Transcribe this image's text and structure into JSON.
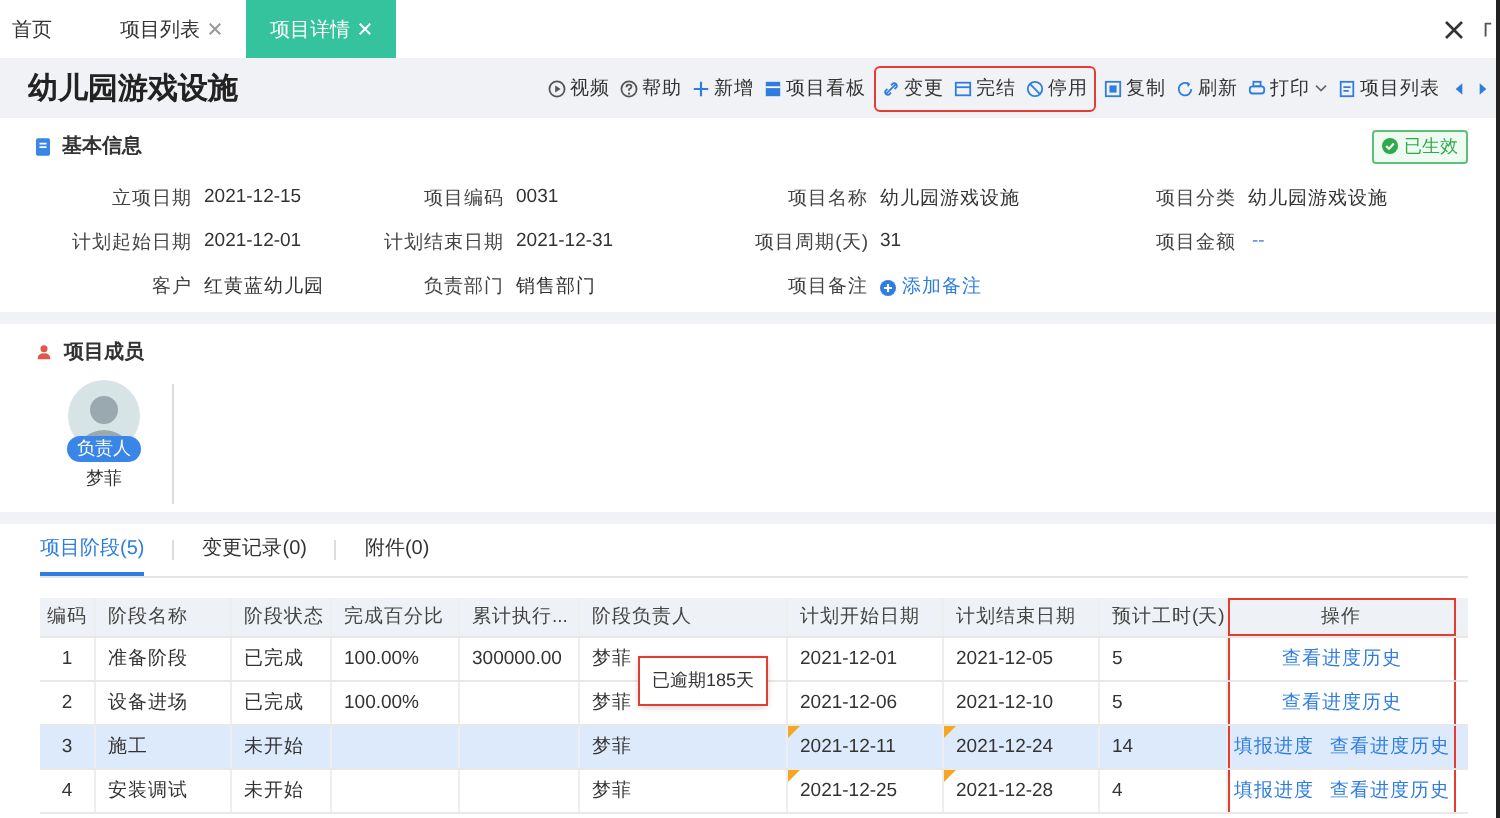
{
  "tabs": [
    {
      "label": "首页",
      "closable": false,
      "selected": false
    },
    {
      "label": "项目列表",
      "closable": true,
      "selected": false
    },
    {
      "label": "项目详情",
      "closable": true,
      "selected": true
    }
  ],
  "title": "幼儿园游戏设施",
  "toolbar_groups": [
    {
      "highlighted": false,
      "items": [
        {
          "label": "视频"
        },
        {
          "label": "帮助"
        },
        {
          "label": "新增"
        },
        {
          "label": "项目看板"
        }
      ]
    },
    {
      "highlighted": true,
      "items": [
        {
          "label": "变更"
        },
        {
          "label": "完结"
        },
        {
          "label": "停用"
        }
      ]
    },
    {
      "highlighted": false,
      "items": [
        {
          "label": "复制"
        },
        {
          "label": "刷新"
        },
        {
          "label": "打印",
          "dropdown": true
        },
        {
          "label": "项目列表"
        }
      ]
    }
  ],
  "basic_info": {
    "heading": "基本信息",
    "status": "已生效",
    "fields": [
      {
        "label": "立项日期",
        "value": "2021-12-15"
      },
      {
        "label": "项目编码",
        "value": "0031"
      },
      {
        "label": "项目名称",
        "value": "幼儿园游戏设施"
      },
      {
        "label": "项目分类",
        "value": "幼儿园游戏设施"
      },
      {
        "label": "计划起始日期",
        "value": "2021-12-01"
      },
      {
        "label": "计划结束日期",
        "value": "2021-12-31"
      },
      {
        "label": "项目周期(天)",
        "value": "31"
      },
      {
        "label": "项目金额",
        "value": "--",
        "kind": "empty"
      },
      {
        "label": "客户",
        "value": "红黄蓝幼儿园"
      },
      {
        "label": "负责部门",
        "value": "销售部门"
      },
      {
        "label": "项目备注",
        "value": "添加备注",
        "kind": "link"
      }
    ]
  },
  "members": {
    "heading": "项目成员",
    "items": [
      {
        "role": "负责人",
        "name": "梦菲"
      }
    ]
  },
  "detail_tabs": [
    {
      "label": "项目阶段(5)",
      "selected": true
    },
    {
      "label": "变更记录(0)",
      "selected": false
    },
    {
      "label": "附件(0)",
      "selected": false
    }
  ],
  "table": {
    "columns": [
      {
        "label": "编码",
        "highlighted": false
      },
      {
        "label": "阶段名称",
        "highlighted": false
      },
      {
        "label": "阶段状态",
        "highlighted": false
      },
      {
        "label": "完成百分比",
        "highlighted": false
      },
      {
        "label": "累计执行...",
        "highlighted": false
      },
      {
        "label": "阶段负责人",
        "highlighted": false
      },
      {
        "label": "计划开始日期",
        "highlighted": false
      },
      {
        "label": "计划结束日期",
        "highlighted": false
      },
      {
        "label": "预计工时(天)",
        "highlighted": false
      },
      {
        "label": "操作",
        "highlighted": true
      }
    ],
    "rows": [
      {
        "selected": false,
        "overdue": false,
        "cells": [
          "1",
          "准备阶段",
          "已完成",
          "100.00%",
          "300000.00",
          "梦菲",
          "2021-12-01",
          "2021-12-05",
          "5"
        ],
        "actions": [
          "查看进度历史"
        ]
      },
      {
        "selected": false,
        "overdue": false,
        "cells": [
          "2",
          "设备进场",
          "已完成",
          "100.00%",
          "",
          "梦菲",
          "2021-12-06",
          "2021-12-10",
          "5"
        ],
        "actions": [
          "查看进度历史"
        ]
      },
      {
        "selected": true,
        "overdue": true,
        "cells": [
          "3",
          "施工",
          "未开始",
          "",
          "",
          "梦菲",
          "2021-12-11",
          "2021-12-24",
          "14"
        ],
        "actions": [
          "填报进度",
          "查看进度历史"
        ]
      },
      {
        "selected": false,
        "overdue": true,
        "cells": [
          "4",
          "安装调试",
          "未开始",
          "",
          "",
          "梦菲",
          "2021-12-25",
          "2021-12-28",
          "4"
        ],
        "actions": [
          "填报进度",
          "查看进度历史"
        ]
      }
    ],
    "tooltip": {
      "text": "已逾期185天",
      "highlighted": true
    }
  }
}
